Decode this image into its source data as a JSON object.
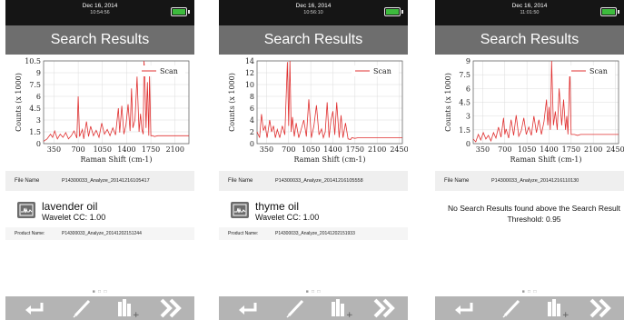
{
  "screens": [
    {
      "status": {
        "date": "Dec 16, 2014",
        "time": "10:54:56"
      },
      "title": "Search Results",
      "file_name_label": "File Name",
      "file_name": "P14300033_Analyze_20141216105417",
      "result_name": "lavender oil",
      "result_cc": "Wavelet CC: 1.00",
      "product_label": "Product Name:",
      "product_name": "P14300033_Analyze_20141202151244",
      "page_dots": "■ □ □"
    },
    {
      "status": {
        "date": "Dec 16, 2014",
        "time": "10:56:10"
      },
      "title": "Search Results",
      "file_name_label": "File Name",
      "file_name": "P14300033_Analyze_20141216105558",
      "result_name": "thyme oil",
      "result_cc": "Wavelet CC: 1.00",
      "product_label": "Product Name:",
      "product_name": "P14300033_Analyze_20141202151933",
      "page_dots": "■ □ □"
    },
    {
      "status": {
        "date": "Dec 16, 2014",
        "time": "11:01:50"
      },
      "title": "Search Results",
      "file_name_label": "File Name",
      "file_name": "P14300033_Analyze_20141216110130",
      "no_results": "No Search Results found above the Search Result Threshold: 0.95",
      "page_dots": "■ □ □"
    }
  ],
  "colors": {
    "status_bar": "#151515",
    "title_bar": "#6e6e6e",
    "battery": "#3dbb3d",
    "scan_line": "#e03030",
    "bottom_bar": "#b4b4b4"
  },
  "icons": [
    "back-arrow-icon",
    "pen-icon",
    "library-add-icon",
    "forward-chevron-icon",
    "spectrum-icon",
    "battery-icon"
  ],
  "chart_data": [
    {
      "type": "line",
      "xlabel": "Raman Shift (cm-1)",
      "ylabel": "Counts (x 1000)",
      "xlim": [
        200,
        2300
      ],
      "ylim": [
        0,
        10.5
      ],
      "xticks": [
        350,
        700,
        1050,
        1400,
        1750,
        2100
      ],
      "yticks": [
        "0",
        "1.5",
        "3",
        "4.5",
        "6",
        "7.5",
        "9",
        "10.5"
      ],
      "grid": true,
      "legend": "top-right",
      "series": [
        {
          "name": "Scan",
          "x": [
            200,
            250,
            300,
            330,
            360,
            400,
            440,
            480,
            520,
            560,
            600,
            640,
            680,
            700,
            720,
            760,
            780,
            820,
            850,
            880,
            920,
            960,
            1000,
            1040,
            1080,
            1120,
            1160,
            1200,
            1240,
            1280,
            1300,
            1330,
            1360,
            1390,
            1420,
            1450,
            1470,
            1490,
            1520,
            1550,
            1580,
            1600,
            1620,
            1640,
            1650,
            1660,
            1680,
            1700,
            1720,
            1730,
            1750,
            1780,
            1800,
            1850,
            1900,
            2000,
            2100,
            2200,
            2300
          ],
          "y": [
            0.3,
            0.6,
            1.2,
            0.8,
            1.6,
            0.6,
            1.2,
            0.8,
            1.4,
            0.6,
            1.0,
            1.6,
            0.7,
            6.0,
            0.9,
            1.8,
            0.6,
            2.8,
            0.9,
            2.2,
            1.0,
            1.7,
            0.8,
            2.6,
            1.2,
            1.8,
            1.0,
            2.0,
            1.1,
            4.5,
            1.4,
            4.8,
            1.2,
            2.4,
            5.0,
            1.6,
            7.0,
            2.0,
            3.0,
            8.5,
            1.5,
            3.8,
            1.8,
            1.2,
            10.5,
            9.5,
            2.0,
            7.8,
            1.0,
            8.8,
            1.0,
            1.0,
            0.9,
            1.0,
            1.0,
            1.0,
            1.0,
            1.0,
            1.0
          ]
        }
      ]
    },
    {
      "type": "line",
      "xlabel": "Raman Shift (cm-1)",
      "ylabel": "Counts (x 1000)",
      "xlim": [
        200,
        2500
      ],
      "ylim": [
        0,
        14
      ],
      "xticks": [
        350,
        700,
        1050,
        1400,
        1750,
        2100,
        2450
      ],
      "yticks": [
        "0",
        "2",
        "4",
        "6",
        "8",
        "10",
        "12",
        "14"
      ],
      "grid": true,
      "legend": "top-right",
      "series": [
        {
          "name": "Scan",
          "x": [
            200,
            240,
            270,
            300,
            330,
            360,
            400,
            430,
            460,
            490,
            520,
            560,
            600,
            640,
            680,
            700,
            720,
            740,
            760,
            790,
            820,
            860,
            900,
            940,
            980,
            1020,
            1060,
            1100,
            1140,
            1180,
            1220,
            1250,
            1280,
            1310,
            1340,
            1370,
            1400,
            1430,
            1460,
            1500,
            1530,
            1560,
            1600,
            1640,
            1680,
            1700,
            1750,
            1800,
            1900,
            2000,
            2100,
            2200,
            2300,
            2400,
            2500
          ],
          "y": [
            2.0,
            1.0,
            5.0,
            2.2,
            3.0,
            1.0,
            4.0,
            2.0,
            3.0,
            1.0,
            2.4,
            1.0,
            3.0,
            1.5,
            13.8,
            3.0,
            14.2,
            2.0,
            4.5,
            1.2,
            3.5,
            1.0,
            2.5,
            4.0,
            1.2,
            7.5,
            1.0,
            3.0,
            6.5,
            1.5,
            2.5,
            1.0,
            2.0,
            7.0,
            1.0,
            4.0,
            5.5,
            1.5,
            7.0,
            1.0,
            4.8,
            1.0,
            3.5,
            0.8,
            0.7,
            1.0,
            0.9,
            1.0,
            1.0,
            1.0,
            1.0,
            1.0,
            1.0,
            1.0,
            1.0
          ]
        }
      ]
    },
    {
      "type": "line",
      "xlabel": "Raman Shift (cm-1)",
      "ylabel": "Counts (x 1000)",
      "xlim": [
        200,
        2500
      ],
      "ylim": [
        0,
        9
      ],
      "xticks": [
        350,
        700,
        1050,
        1400,
        1750,
        2100,
        2450
      ],
      "yticks": [
        "0",
        "1.5",
        "3",
        "4.5",
        "6",
        "7.5",
        "9"
      ],
      "grid": true,
      "legend": "top-right",
      "series": [
        {
          "name": "Scan",
          "x": [
            200,
            240,
            280,
            320,
            360,
            400,
            440,
            480,
            520,
            560,
            600,
            640,
            680,
            700,
            720,
            760,
            800,
            840,
            880,
            920,
            960,
            1000,
            1040,
            1080,
            1120,
            1160,
            1200,
            1240,
            1280,
            1320,
            1360,
            1380,
            1400,
            1420,
            1440,
            1470,
            1500,
            1530,
            1560,
            1600,
            1630,
            1660,
            1680,
            1700,
            1730,
            1750,
            1780,
            1800,
            1850,
            1900,
            2000,
            2100,
            2200,
            2300,
            2400,
            2500
          ],
          "y": [
            0.5,
            0.2,
            1.0,
            0.4,
            1.2,
            0.5,
            0.9,
            0.3,
            1.2,
            0.6,
            1.8,
            0.7,
            2.8,
            1.0,
            1.6,
            0.6,
            2.6,
            0.9,
            3.1,
            0.8,
            1.4,
            2.8,
            1.0,
            1.8,
            0.9,
            3.0,
            1.2,
            2.6,
            1.0,
            2.4,
            4.8,
            2.0,
            4.0,
            1.5,
            9.0,
            2.0,
            3.5,
            1.5,
            6.0,
            2.0,
            4.8,
            1.5,
            3.0,
            1.0,
            8.2,
            1.0,
            1.0,
            1.0,
            0.9,
            1.0,
            1.0,
            1.0,
            1.0,
            1.0,
            1.0,
            1.0
          ]
        }
      ]
    }
  ]
}
